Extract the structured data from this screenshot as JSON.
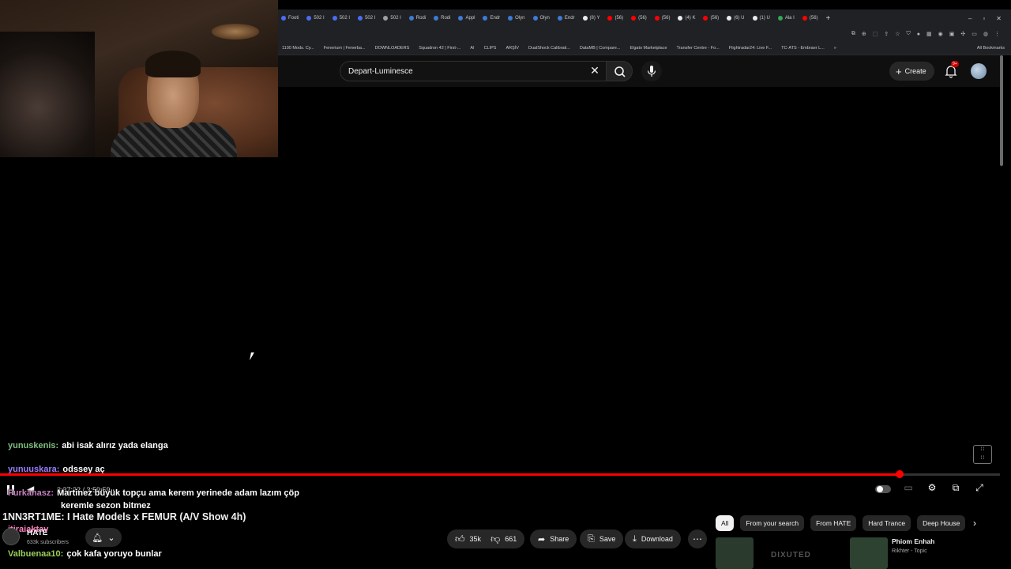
{
  "browser": {
    "tabs": [
      {
        "label": "Footi",
        "color": "#4a6cf7"
      },
      {
        "label": "502 I",
        "color": "#4a6cf7"
      },
      {
        "label": "502 I",
        "color": "#4a6cf7"
      },
      {
        "label": "502 I",
        "color": "#4a6cf7"
      },
      {
        "label": "502 I",
        "color": "#9aa0a6"
      },
      {
        "label": "Rodi",
        "color": "#3d7bd9"
      },
      {
        "label": "Rodi",
        "color": "#3d7bd9"
      },
      {
        "label": "Appl",
        "color": "#3d7bd9"
      },
      {
        "label": "Endr",
        "color": "#3d7bd9"
      },
      {
        "label": "Olyn",
        "color": "#3d7bd9"
      },
      {
        "label": "Olyn",
        "color": "#3d7bd9"
      },
      {
        "label": "Endr",
        "color": "#3d7bd9"
      },
      {
        "label": "(8) Y",
        "color": "#e8eaed"
      },
      {
        "label": "(56)",
        "color": "#ff0000"
      },
      {
        "label": "(56)",
        "color": "#ff0000"
      },
      {
        "label": "(56)",
        "color": "#ff0000"
      },
      {
        "label": "(4) K",
        "color": "#e8eaed"
      },
      {
        "label": "(56)",
        "color": "#ff0000"
      },
      {
        "label": "(6) U",
        "color": "#e8eaed"
      },
      {
        "label": "(1) U",
        "color": "#e8eaed"
      },
      {
        "label": "Ala I",
        "color": "#34a853"
      },
      {
        "label": "(56)",
        "color": "#ff0000"
      }
    ],
    "new_tab": "+",
    "bookmarks": [
      "1100 Mods. Cy...",
      "Fenerium | Fenerba...",
      "DOWNLOADERS",
      "Squadron 42 | First-...",
      "AI",
      "CLIPS",
      "ARŞİV",
      "DualShock Calibrati...",
      "DataMB | Compare...",
      "Elgato Marketplace",
      "Transfer Centre - Fo...",
      "Flightradar24: Live F...",
      "TC-ATS - Embraer L..."
    ],
    "bookmarks_more": "»",
    "all_bookmarks": "All Bookmarks"
  },
  "youtube": {
    "search_value": "Depart-Luminesce",
    "create_label": "Create",
    "notif_badge": "9+"
  },
  "chat": {
    "messages": [
      {
        "user": "yunuskenis:",
        "text": "abi isak alırız yada elanga",
        "color": "#7fbf7f"
      },
      {
        "user": "yunuuskara:",
        "text": "odssey aç",
        "color": "#9a7fff"
      },
      {
        "user": "Furkanasz:",
        "text": "Martinez büyük topçu ama kerem yerinede adam lazım çöp",
        "color": "#c77fbf"
      },
      {
        "user": "",
        "text": "keremle sezon bitmez",
        "color": "#ffffff"
      },
      {
        "user": "itiraiaktav",
        "text": "",
        "color": "#ff7fbf"
      },
      {
        "user": "Valbuenaa10:",
        "text": "çok kafa yoruyo bunlar",
        "color": "#9acd5a"
      }
    ]
  },
  "player": {
    "time": "3:37:22 / 3:59:59",
    "progress": 0.9
  },
  "video": {
    "title": "1NN3RT1ME: I Hate Models x FEMUR (A/V Show 4h)",
    "channel": "HATE",
    "subscribers": "633k subscribers",
    "likes": "35k",
    "dislikes": "661",
    "share_label": "Share",
    "save_label": "Save",
    "download_label": "Download"
  },
  "recommendations": {
    "chips": [
      "All",
      "From your search",
      "From HATE",
      "Hard Trance",
      "Deep House"
    ],
    "thumb_text": "DIXUTED",
    "title": "Phiom Enhah",
    "artist": "Rikhter - Topic"
  }
}
